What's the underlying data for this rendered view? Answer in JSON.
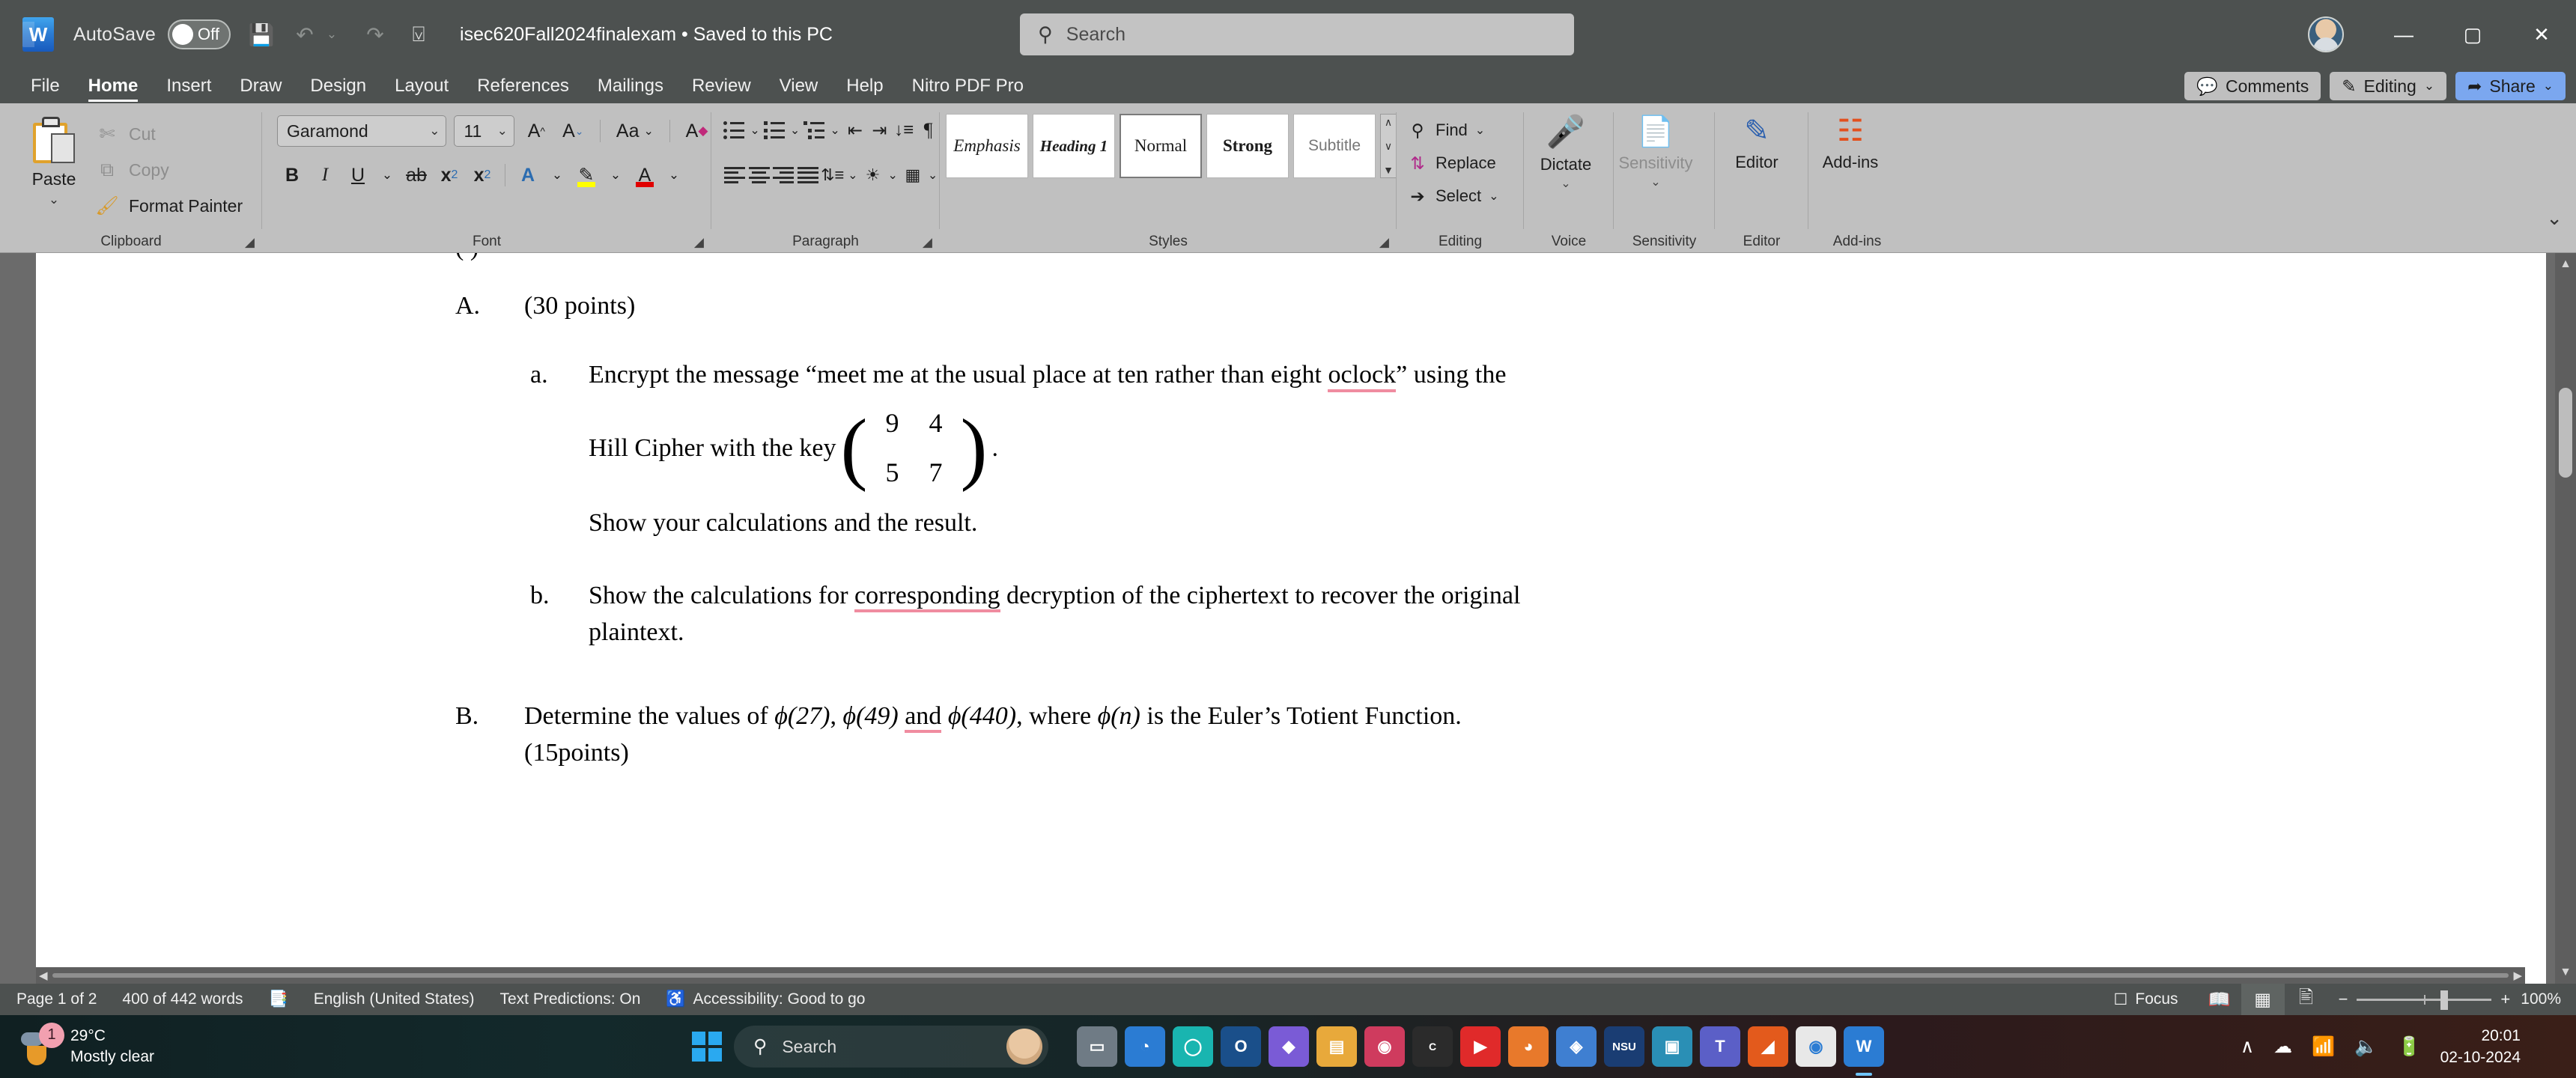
{
  "titlebar": {
    "app_logo": "W",
    "autosave_label": "AutoSave",
    "autosave_state": "Off",
    "save_icon": "save-icon",
    "undo_icon": "undo-icon",
    "redo_icon": "redo-icon",
    "customize_icon": "customize-quick-access-icon",
    "document_title": "isec620Fall2024finalexam • Saved to this PC",
    "title_chevron": "⌄",
    "search_placeholder": "Search",
    "minimize": "—",
    "maximize": "▢",
    "close": "✕"
  },
  "tabs": [
    {
      "label": "File",
      "active": false
    },
    {
      "label": "Home",
      "active": true
    },
    {
      "label": "Insert",
      "active": false
    },
    {
      "label": "Draw",
      "active": false
    },
    {
      "label": "Design",
      "active": false
    },
    {
      "label": "Layout",
      "active": false
    },
    {
      "label": "References",
      "active": false
    },
    {
      "label": "Mailings",
      "active": false
    },
    {
      "label": "Review",
      "active": false
    },
    {
      "label": "View",
      "active": false
    },
    {
      "label": "Help",
      "active": false
    },
    {
      "label": "Nitro PDF Pro",
      "active": false
    }
  ],
  "tab_actions": {
    "comments": "Comments",
    "editing": "Editing",
    "editing_chevron": "⌄",
    "share": "Share",
    "share_chevron": "⌄"
  },
  "ribbon": {
    "clipboard": {
      "group_name": "Clipboard",
      "paste": "Paste",
      "paste_chevron": "⌄",
      "cut": "Cut",
      "copy": "Copy",
      "format_painter": "Format Painter"
    },
    "font": {
      "group_name": "Font",
      "font_name": "Garamond",
      "font_size": "11",
      "grow_font": "A",
      "shrink_font": "A",
      "change_case": "Aa",
      "clear_formatting": "A",
      "bold": "B",
      "italic": "I",
      "underline": "U",
      "strikethrough": "ab",
      "subscript": "x",
      "subscript_sub": "2",
      "superscript": "x",
      "superscript_sup": "2",
      "text_effects": "A",
      "highlight": "A",
      "highlight_color": "#ffff00",
      "font_color": "A",
      "font_color_value": "#e00000"
    },
    "paragraph": {
      "group_name": "Paragraph",
      "bullets": "bullets-icon",
      "numbering": "numbering-icon",
      "multilevel": "multilevel-list-icon",
      "decrease_indent": "decrease-indent-icon",
      "increase_indent": "increase-indent-icon",
      "sort": "sort-icon",
      "show_marks": "¶",
      "align_left": "align-left-icon",
      "align_center": "align-center-icon",
      "align_right": "align-right-icon",
      "justify": "justify-icon",
      "line_spacing": "line-spacing-icon",
      "shading": "shading-icon",
      "borders": "borders-icon"
    },
    "styles": {
      "group_name": "Styles",
      "items": [
        {
          "label": "Emphasis",
          "selected": false
        },
        {
          "label": "Heading 1",
          "selected": false
        },
        {
          "label": "Normal",
          "selected": true
        },
        {
          "label": "Strong",
          "selected": false
        },
        {
          "label": "Subtitle",
          "selected": false
        }
      ],
      "scroll_up": "∧",
      "scroll_down": "∨",
      "more": "▼"
    },
    "editing": {
      "group_name": "Editing",
      "find": "Find",
      "find_chevron": "⌄",
      "replace": "Replace",
      "select": "Select",
      "select_chevron": "⌄"
    },
    "voice": {
      "group_name": "Voice",
      "dictate": "Dictate",
      "chevron": "⌄"
    },
    "sensitivity": {
      "group_name": "Sensitivity",
      "label": "Sensitivity",
      "chevron": "⌄"
    },
    "editor": {
      "group_name": "Editor",
      "label": "Editor"
    },
    "addins": {
      "group_name": "Add-ins",
      "label": "Add-ins"
    },
    "collapse": "⌄"
  },
  "document": {
    "clipped_top_line": "(                                                  )",
    "item_A": {
      "marker": "A.",
      "text": "(30 points)"
    },
    "item_a": {
      "marker": "a.",
      "text_before": "Encrypt the message “meet me at the usual place at ten rather than eight ",
      "misspelled": "oclock",
      "text_after": "” using the",
      "line2_before": "Hill Cipher with the key",
      "matrix": [
        "9",
        "4",
        "5",
        "7"
      ],
      "line2_after": ".",
      "line3": "Show your calculations and the result."
    },
    "item_b": {
      "marker": "b.",
      "text_before": "Show the calculations for ",
      "flagged": "corresponding",
      "text_after": " decryption of the ciphertext to recover the original",
      "line2": "plaintext."
    },
    "item_B": {
      "marker": "B.",
      "part1": "Determine the values of ",
      "phi1": "ϕ(27)",
      "sep1": ", ",
      "phi2": "ϕ(49)",
      "flagged": "and",
      "phi3": "ϕ(440)",
      "part2": ", where ",
      "phi_n": "ϕ(n)",
      "part3": " is the Euler’s Totient Function.",
      "line2": "(15points)"
    }
  },
  "statusbar": {
    "page": "Page 1 of 2",
    "words": "400 of 442 words",
    "proofing_icon": "proofing-errors-icon",
    "language": "English (United States)",
    "predictions": "Text Predictions: On",
    "accessibility": "Accessibility: Good to go",
    "focus": "Focus",
    "view_read": "read-mode-icon",
    "view_print": "print-layout-icon",
    "view_web": "web-layout-icon",
    "zoom_out": "−",
    "zoom_in": "+",
    "zoom_level": "100%"
  },
  "taskbar": {
    "weather_temp": "29°C",
    "weather_desc": "Mostly clear",
    "weather_badge": "1",
    "start": "start-button",
    "search_placeholder": "Search",
    "apps": [
      {
        "name": "task-view",
        "glyph": "▭",
        "color": "#6f7b85",
        "active": false
      },
      {
        "name": "edge",
        "glyph": "◔",
        "color": "#2b7cd3",
        "active": false
      },
      {
        "name": "teams-classic",
        "glyph": "◯",
        "color": "#19b5b0",
        "active": false
      },
      {
        "name": "outlook",
        "glyph": "O",
        "color": "#1a4f8a",
        "active": false
      },
      {
        "name": "app-purple",
        "glyph": "◆",
        "color": "#7a5bd6",
        "active": false
      },
      {
        "name": "file-explorer",
        "glyph": "▤",
        "color": "#e8a93b",
        "active": false
      },
      {
        "name": "search-app",
        "glyph": "◉",
        "color": "#cf3b5e",
        "active": false
      },
      {
        "name": "cyberay",
        "glyph": "C",
        "color": "#2b2b2b",
        "active": false
      },
      {
        "name": "youtube",
        "glyph": "▶",
        "color": "#e02a2a",
        "active": false
      },
      {
        "name": "firefox",
        "glyph": "◕",
        "color": "#e8792b",
        "active": false
      },
      {
        "name": "app-blue",
        "glyph": "◈",
        "color": "#3f7fd1",
        "active": false
      },
      {
        "name": "nsu",
        "glyph": "NSU",
        "color": "#1a3d73",
        "active": false
      },
      {
        "name": "app-teal",
        "glyph": "▣",
        "color": "#2a8fb5",
        "active": false
      },
      {
        "name": "teams",
        "glyph": "T",
        "color": "#5b5fc7",
        "active": false
      },
      {
        "name": "brave",
        "glyph": "◢",
        "color": "#e35a1c",
        "active": false
      },
      {
        "name": "chrome",
        "glyph": "◉",
        "color": "#e8e8e8",
        "active": false
      },
      {
        "name": "word",
        "glyph": "W",
        "color": "#2b7cd3",
        "active": true
      }
    ],
    "tray_expand": "∧",
    "onedrive": "onedrive-icon",
    "wifi": "wifi-icon",
    "volume": "volume-icon",
    "battery": "battery-charging-icon",
    "time": "20:01",
    "date": "02-10-2024",
    "notifications": "notification-bell-icon"
  }
}
